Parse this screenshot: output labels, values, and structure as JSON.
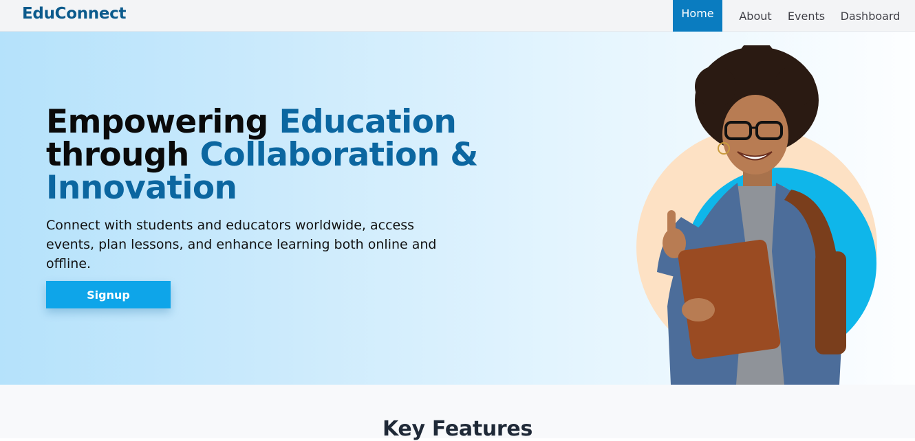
{
  "brand": "EduConnect",
  "nav": {
    "home": "Home",
    "about": "About",
    "events": "Events",
    "dashboard": "Dashboard"
  },
  "hero": {
    "headline_part1": "Empowering ",
    "headline_accent1": "Education",
    "headline_part2": "through ",
    "headline_accent2": "Collaboration &",
    "headline_accent3": "Innovation",
    "subtext": "Connect with students and educators worldwide, access events, plan lessons, and enhance learning both online and offline.",
    "cta": "Signup"
  },
  "features": {
    "title": "Key Features"
  },
  "colors": {
    "brand": "#0b5a8c",
    "accent": "#0b66a0",
    "nav_active": "#0a7cc0",
    "button": "#0ea5e9",
    "circle_peach": "#fde1c4",
    "circle_blue": "#0fb6ea"
  }
}
